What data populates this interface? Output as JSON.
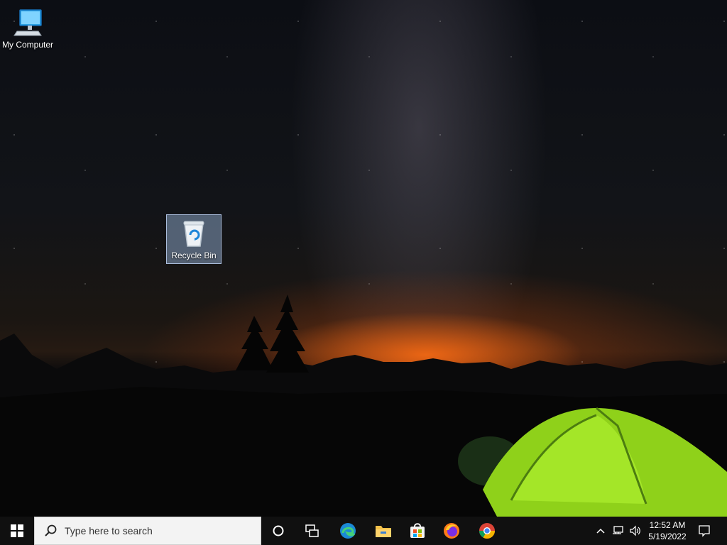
{
  "desktop": {
    "icons": [
      {
        "label": "My Computer",
        "icon": "computer-icon"
      },
      {
        "label": "Recycle Bin",
        "icon": "recycle-bin-icon",
        "selected": true
      }
    ]
  },
  "taskbar": {
    "start": {
      "icon": "windows-logo-icon"
    },
    "search": {
      "placeholder": "Type here to search",
      "icon": "search-icon"
    },
    "pinned": [
      {
        "name": "Cortana",
        "icon": "cortana-circle-icon"
      },
      {
        "name": "Task View",
        "icon": "task-view-icon"
      },
      {
        "name": "Microsoft Edge",
        "icon": "edge-icon"
      },
      {
        "name": "File Explorer",
        "icon": "folder-icon"
      },
      {
        "name": "Microsoft Store",
        "icon": "store-icon"
      },
      {
        "name": "Firefox",
        "icon": "firefox-icon"
      },
      {
        "name": "Chrome",
        "icon": "chrome-icon"
      }
    ],
    "tray": {
      "icons": [
        "chevron-up-icon",
        "network-icon",
        "volume-icon"
      ],
      "time": "12:52 AM",
      "date": "5/19/2022",
      "notification_icon": "action-center-icon"
    }
  },
  "colors": {
    "taskbar_bg": "#101010",
    "search_bg": "#f3f3f3",
    "selection": "#a0bee6"
  }
}
